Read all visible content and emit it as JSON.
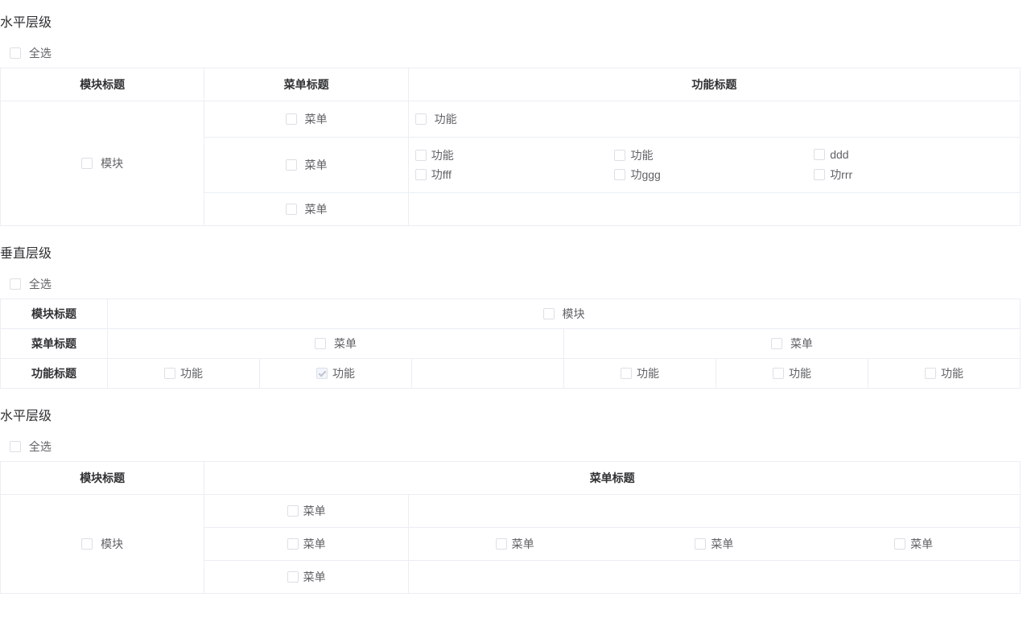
{
  "section1": {
    "title": "水平层级",
    "select_all": "全选",
    "headers": {
      "module": "模块标题",
      "menu": "菜单标题",
      "fn": "功能标题"
    },
    "module_label": "模块",
    "rows": [
      {
        "menu": "菜单",
        "fns": [
          "功能"
        ]
      },
      {
        "menu": "菜单",
        "fns": [
          "功能",
          "功能",
          "ddd",
          "功fff",
          "功ggg",
          "功rrr"
        ]
      },
      {
        "menu": "菜单",
        "fns": []
      }
    ]
  },
  "section2": {
    "title": "垂直层级",
    "select_all": "全选",
    "headers": {
      "module": "模块标题",
      "menu": "菜单标题",
      "fn": "功能标题"
    },
    "module_label": "模块",
    "menus": [
      "菜单",
      "菜单"
    ],
    "fns": [
      {
        "label": "功能",
        "disabled": false
      },
      {
        "label": "功能",
        "disabled": true
      },
      {
        "label": "",
        "empty": true
      },
      {
        "label": "功能",
        "disabled": false
      },
      {
        "label": "功能",
        "disabled": false
      },
      {
        "label": "功能",
        "disabled": false
      }
    ]
  },
  "section3": {
    "title": "水平层级",
    "select_all": "全选",
    "headers": {
      "module": "模块标题",
      "menu": "菜单标题"
    },
    "module_label": "模块",
    "rows": [
      {
        "menu": "菜单",
        "extra": []
      },
      {
        "menu": "菜单",
        "extra": [
          "菜单",
          "菜单",
          "菜单"
        ]
      },
      {
        "menu": "菜单",
        "extra": []
      }
    ]
  }
}
